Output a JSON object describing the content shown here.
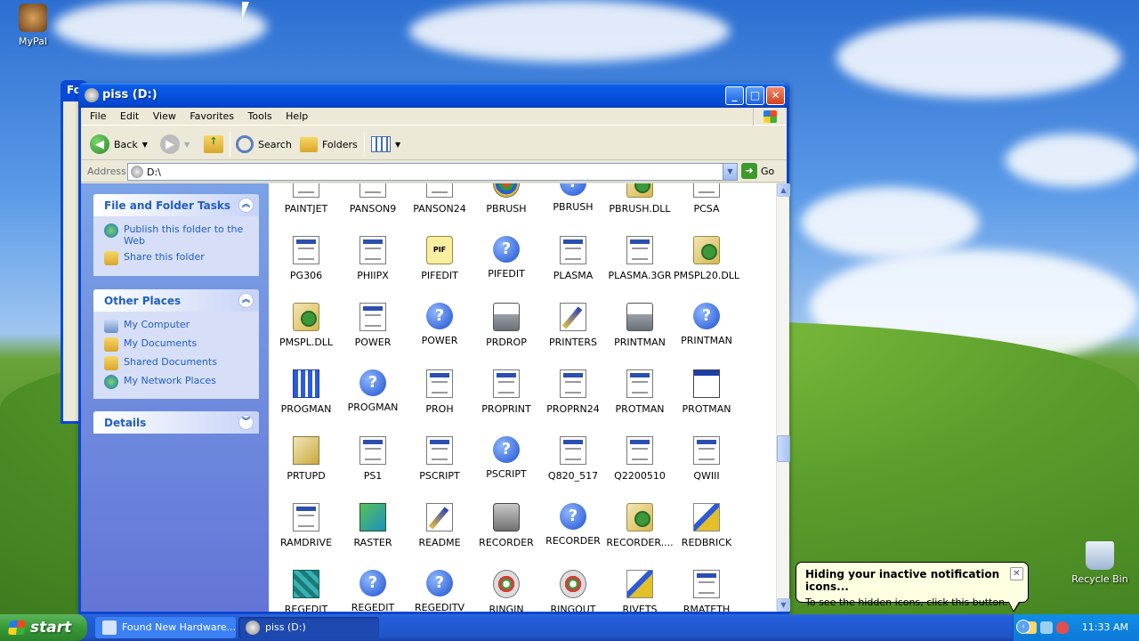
{
  "desktop": {
    "icons": [
      {
        "label": "MyPal",
        "icon": "mypal-icon"
      },
      {
        "label": "Recycle Bin",
        "icon": "recycle-bin-icon"
      }
    ],
    "ghost_window_title": "Fo"
  },
  "window": {
    "title": "piss (D:)",
    "menu": [
      "File",
      "Edit",
      "View",
      "Favorites",
      "Tools",
      "Help"
    ],
    "toolbar": {
      "back": "Back",
      "search": "Search",
      "folders": "Folders"
    },
    "address": {
      "label": "Address",
      "value": "D:\\",
      "go": "Go"
    },
    "tasks": {
      "file_folder": {
        "title": "File and Folder Tasks",
        "items": [
          "Publish this folder to the Web",
          "Share this folder"
        ]
      },
      "other_places": {
        "title": "Other Places",
        "items": [
          "My Computer",
          "My Documents",
          "Shared Documents",
          "My Network Places"
        ]
      },
      "details": {
        "title": "Details"
      }
    },
    "files": [
      {
        "name": "PAINTJET",
        "icon": "doc"
      },
      {
        "name": "PANSON9",
        "icon": "doc"
      },
      {
        "name": "PANSON24",
        "icon": "doc"
      },
      {
        "name": "PBRUSH",
        "icon": "paint"
      },
      {
        "name": "PBRUSH",
        "icon": "help"
      },
      {
        "name": "PBRUSH.DLL",
        "icon": "gear"
      },
      {
        "name": "PCSA",
        "icon": "doc"
      },
      {
        "name": "PG306",
        "icon": "doc"
      },
      {
        "name": "PHIIPX",
        "icon": "doc"
      },
      {
        "name": "PIFEDIT",
        "icon": "pif"
      },
      {
        "name": "PIFEDIT",
        "icon": "help"
      },
      {
        "name": "PLASMA",
        "icon": "doc"
      },
      {
        "name": "PLASMA.3GR",
        "icon": "doc"
      },
      {
        "name": "PMSPL20.DLL",
        "icon": "gear"
      },
      {
        "name": "PMSPL.DLL",
        "icon": "gear"
      },
      {
        "name": "POWER",
        "icon": "doc"
      },
      {
        "name": "POWER",
        "icon": "help"
      },
      {
        "name": "PRDROP",
        "icon": "printer"
      },
      {
        "name": "PRINTERS",
        "icon": "pen"
      },
      {
        "name": "PRINTMAN",
        "icon": "printer"
      },
      {
        "name": "PRINTMAN",
        "icon": "help"
      },
      {
        "name": "PROGMAN",
        "icon": "prog"
      },
      {
        "name": "PROGMAN",
        "icon": "help"
      },
      {
        "name": "PROH",
        "icon": "doc"
      },
      {
        "name": "PROPRINT",
        "icon": "doc"
      },
      {
        "name": "PROPRN24",
        "icon": "doc"
      },
      {
        "name": "PROTMAN",
        "icon": "doc"
      },
      {
        "name": "PROTMAN",
        "icon": "app"
      },
      {
        "name": "PRTUPD",
        "icon": "mscall"
      },
      {
        "name": "PS1",
        "icon": "doc"
      },
      {
        "name": "PSCRIPT",
        "icon": "doc"
      },
      {
        "name": "PSCRIPT",
        "icon": "help"
      },
      {
        "name": "Q820_517",
        "icon": "doc"
      },
      {
        "name": "Q2200510",
        "icon": "doc"
      },
      {
        "name": "QWIII",
        "icon": "doc"
      },
      {
        "name": "RAMDRIVE",
        "icon": "doc"
      },
      {
        "name": "RASTER",
        "icon": "raster"
      },
      {
        "name": "README",
        "icon": "pen"
      },
      {
        "name": "RECORDER",
        "icon": "camera"
      },
      {
        "name": "RECORDER",
        "icon": "help"
      },
      {
        "name": "RECORDER....",
        "icon": "gear"
      },
      {
        "name": "REDBRICK",
        "icon": "rivet"
      },
      {
        "name": "REGEDIT",
        "icon": "regedit"
      },
      {
        "name": "REGEDIT",
        "icon": "help"
      },
      {
        "name": "REGEDITV",
        "icon": "help"
      },
      {
        "name": "RINGIN",
        "icon": "disc"
      },
      {
        "name": "RINGOUT",
        "icon": "disc"
      },
      {
        "name": "RIVETS",
        "icon": "rivet"
      },
      {
        "name": "RMATETH",
        "icon": "doc"
      }
    ]
  },
  "taskbar": {
    "start": "start",
    "tasks": [
      "Found New Hardware...",
      "piss (D:)"
    ],
    "clock": "11:33 AM"
  },
  "balloon": {
    "title": "Hiding your inactive notification icons...",
    "text": "To see the hidden icons, click this button."
  }
}
